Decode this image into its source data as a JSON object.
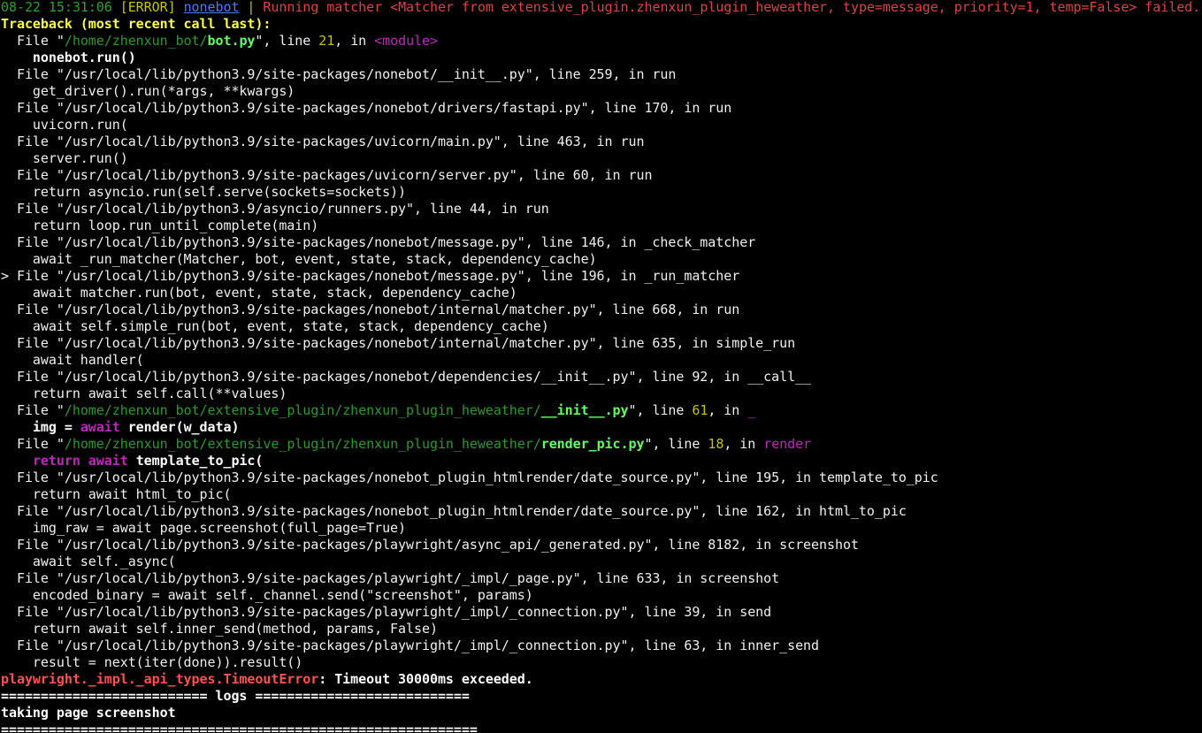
{
  "header": {
    "timestamp": "08-22 15:31:06",
    "level": "[ERROR]",
    "logger": "nonebot",
    "separator": " | ",
    "message": "Running matcher <Matcher from extensive_plugin.zhenxun_plugin_heweather, type=message, priority=1, temp=False> failed."
  },
  "traceback_title": "Traceback (most recent call last):",
  "frames": [
    {
      "kind": "local",
      "prefix": "  File \"",
      "dir": "/home/zhenxun_bot/",
      "file": "bot.py",
      "mid": "\", line ",
      "lineno": "21",
      "in": ", in ",
      "func": "<module>",
      "code": "    nonebot.run()"
    },
    {
      "kind": "plain",
      "text": "  File \"/usr/local/lib/python3.9/site-packages/nonebot/__init__.py\", line 259, in run",
      "code": "    get_driver().run(*args, **kwargs)"
    },
    {
      "kind": "plain",
      "text": "  File \"/usr/local/lib/python3.9/site-packages/nonebot/drivers/fastapi.py\", line 170, in run",
      "code": "    uvicorn.run("
    },
    {
      "kind": "plain",
      "text": "  File \"/usr/local/lib/python3.9/site-packages/uvicorn/main.py\", line 463, in run",
      "code": "    server.run()"
    },
    {
      "kind": "plain",
      "text": "  File \"/usr/local/lib/python3.9/site-packages/uvicorn/server.py\", line 60, in run",
      "code": "    return asyncio.run(self.serve(sockets=sockets))"
    },
    {
      "kind": "plain",
      "text": "  File \"/usr/local/lib/python3.9/asyncio/runners.py\", line 44, in run",
      "code": "    return loop.run_until_complete(main)"
    },
    {
      "kind": "plain",
      "text": "  File \"/usr/local/lib/python3.9/site-packages/nonebot/message.py\", line 146, in _check_matcher",
      "code": "    await _run_matcher(Matcher, bot, event, state, stack, dependency_cache)"
    },
    {
      "kind": "plain",
      "text": "> File \"/usr/local/lib/python3.9/site-packages/nonebot/message.py\", line 196, in _run_matcher",
      "code": "    await matcher.run(bot, event, state, stack, dependency_cache)"
    },
    {
      "kind": "plain",
      "text": "  File \"/usr/local/lib/python3.9/site-packages/nonebot/internal/matcher.py\", line 668, in run",
      "code": "    await self.simple_run(bot, event, state, stack, dependency_cache)"
    },
    {
      "kind": "plain",
      "text": "  File \"/usr/local/lib/python3.9/site-packages/nonebot/internal/matcher.py\", line 635, in simple_run",
      "code": "    await handler("
    },
    {
      "kind": "plain",
      "text": "  File \"/usr/local/lib/python3.9/site-packages/nonebot/dependencies/__init__.py\", line 92, in __call__",
      "code": "    return await self.call(**values)"
    },
    {
      "kind": "local2",
      "prefix": "  File \"",
      "dir": "/home/zhenxun_bot/extensive_plugin/zhenxun_plugin_heweather/",
      "file": "__init__.py",
      "mid": "\", line ",
      "lineno": "61",
      "in": ", in ",
      "func": "_",
      "code_a": "    img = ",
      "code_b": "await",
      "code_c": " render(w_data)"
    },
    {
      "kind": "local3",
      "prefix": "  File \"",
      "dir": "/home/zhenxun_bot/extensive_plugin/zhenxun_plugin_heweather/",
      "file": "render_pic.py",
      "mid": "\", line ",
      "lineno": "18",
      "in": ", in ",
      "func": "render",
      "code_a": "    ",
      "code_b": "return await",
      "code_c": " template_to_pic("
    },
    {
      "kind": "plain",
      "text": "  File \"/usr/local/lib/python3.9/site-packages/nonebot_plugin_htmlrender/date_source.py\", line 195, in template_to_pic",
      "code": "    return await html_to_pic("
    },
    {
      "kind": "plain",
      "text": "  File \"/usr/local/lib/python3.9/site-packages/nonebot_plugin_htmlrender/date_source.py\", line 162, in html_to_pic",
      "code": "    img_raw = await page.screenshot(full_page=True)"
    },
    {
      "kind": "plain",
      "text": "  File \"/usr/local/lib/python3.9/site-packages/playwright/async_api/_generated.py\", line 8182, in screenshot",
      "code": "    await self._async("
    },
    {
      "kind": "plain",
      "text": "  File \"/usr/local/lib/python3.9/site-packages/playwright/_impl/_page.py\", line 633, in screenshot",
      "code": "    encoded_binary = await self._channel.send(\"screenshot\", params)"
    },
    {
      "kind": "plain",
      "text": "  File \"/usr/local/lib/python3.9/site-packages/playwright/_impl/_connection.py\", line 39, in send",
      "code": "    return await self.inner_send(method, params, False)"
    },
    {
      "kind": "plain",
      "text": "  File \"/usr/local/lib/python3.9/site-packages/playwright/_impl/_connection.py\", line 63, in inner_send",
      "code": "    result = next(iter(done)).result()"
    }
  ],
  "exception": {
    "type": "playwright._impl._api_types.TimeoutError",
    "colon": ": ",
    "message": "Timeout 30000ms exceeded."
  },
  "logs_separator": "========================== logs ===========================",
  "log_line": "taking page screenshot",
  "end_separator": "============================================================",
  "colors": {
    "background": "#000000",
    "timestamp": "#26a526",
    "error_level": "#c9c500",
    "logger_link": "#4a78ff",
    "error_message": "#e04040",
    "traceback_title": "#ffff40",
    "local_path": "#2a9a2a",
    "local_file": "#60ff60",
    "lineno": "#c8c000",
    "func": "#c025c0",
    "exception_type": "#ff5050"
  }
}
